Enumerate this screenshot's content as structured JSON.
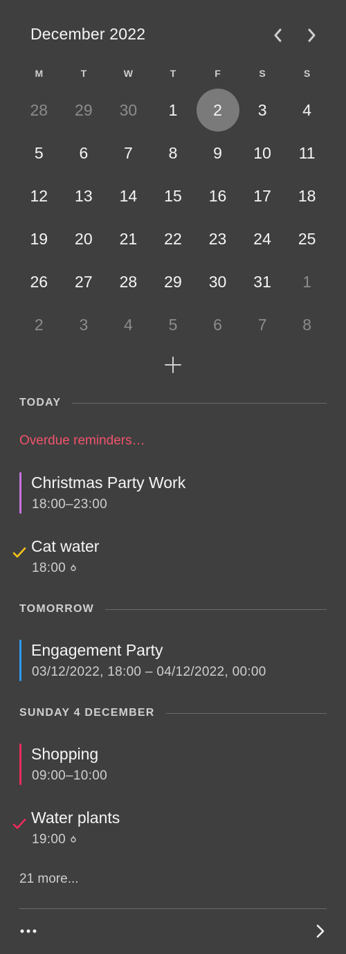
{
  "calendar": {
    "month_title": "December 2022",
    "weekdays": [
      "M",
      "T",
      "W",
      "T",
      "F",
      "S",
      "S"
    ],
    "weeks": [
      [
        {
          "d": "28",
          "m": true
        },
        {
          "d": "29",
          "m": true
        },
        {
          "d": "30",
          "m": true
        },
        {
          "d": "1"
        },
        {
          "d": "2",
          "sel": true
        },
        {
          "d": "3"
        },
        {
          "d": "4"
        }
      ],
      [
        {
          "d": "5"
        },
        {
          "d": "6"
        },
        {
          "d": "7"
        },
        {
          "d": "8"
        },
        {
          "d": "9"
        },
        {
          "d": "10"
        },
        {
          "d": "11"
        }
      ],
      [
        {
          "d": "12"
        },
        {
          "d": "13"
        },
        {
          "d": "14"
        },
        {
          "d": "15"
        },
        {
          "d": "16"
        },
        {
          "d": "17"
        },
        {
          "d": "18"
        }
      ],
      [
        {
          "d": "19"
        },
        {
          "d": "20"
        },
        {
          "d": "21"
        },
        {
          "d": "22"
        },
        {
          "d": "23"
        },
        {
          "d": "24"
        },
        {
          "d": "25"
        }
      ],
      [
        {
          "d": "26"
        },
        {
          "d": "27"
        },
        {
          "d": "28"
        },
        {
          "d": "29"
        },
        {
          "d": "30"
        },
        {
          "d": "31"
        },
        {
          "d": "1",
          "m": true
        }
      ],
      [
        {
          "d": "2",
          "m": true
        },
        {
          "d": "3",
          "m": true
        },
        {
          "d": "4",
          "m": true
        },
        {
          "d": "5",
          "m": true
        },
        {
          "d": "6",
          "m": true
        },
        {
          "d": "7",
          "m": true
        },
        {
          "d": "8",
          "m": true
        }
      ]
    ],
    "selected_color": "#7a7a7a"
  },
  "sections": {
    "today": {
      "title": "TODAY",
      "overdue": "Overdue reminders…",
      "events": [
        {
          "title": "Christmas Party Work",
          "time": "18:00–23:00",
          "color": "#c872e0"
        }
      ],
      "reminders": [
        {
          "title": "Cat water",
          "time": "18:00",
          "color": "#f5c518"
        }
      ]
    },
    "tomorrow": {
      "title": "TOMORROW",
      "events": [
        {
          "title": "Engagement Party",
          "time": "03/12/2022, 18:00 – 04/12/2022, 00:00",
          "color": "#2d9cf0"
        }
      ]
    },
    "sunday": {
      "title": "SUNDAY 4 DECEMBER",
      "events": [
        {
          "title": "Shopping",
          "time": "09:00–10:00",
          "color": "#ee2b5e"
        }
      ],
      "reminders": [
        {
          "title": "Water plants",
          "time": "19:00",
          "color": "#ee2b5e"
        }
      ]
    }
  },
  "footer": {
    "more": "21 more..."
  },
  "icons": {
    "prev": "chevron-left-icon",
    "next": "chevron-right-icon",
    "add": "plus-icon",
    "check": "checkmark-icon",
    "bell": "alarm-icon",
    "more": "ellipsis-icon",
    "forward": "chevron-right-icon"
  }
}
